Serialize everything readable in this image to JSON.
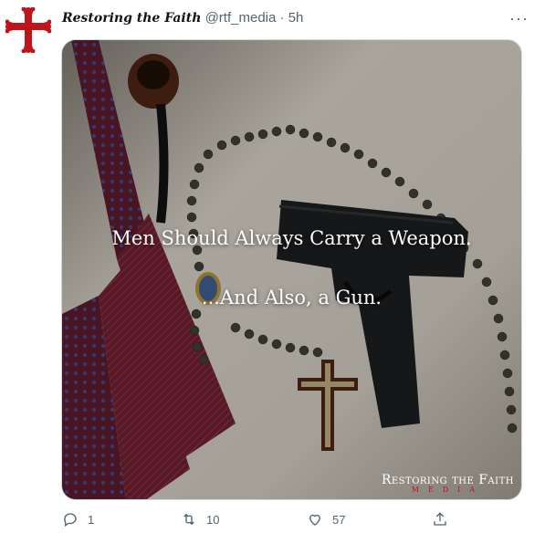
{
  "tweet": {
    "display_name": "Restoring the Faith",
    "handle": "@rtf_media",
    "separator": "·",
    "time": "5h",
    "more_label": "···"
  },
  "media": {
    "headline": "Men Should Always Carry a Weapon.",
    "subline": "...And Also, a Gun.",
    "brand_name": "Restoring the Faith",
    "brand_sub": "MEDIA"
  },
  "actions": {
    "reply_count": "1",
    "retweet_count": "10",
    "like_count": "57"
  },
  "colors": {
    "brand_red": "#c0141c",
    "muted": "#536471"
  }
}
